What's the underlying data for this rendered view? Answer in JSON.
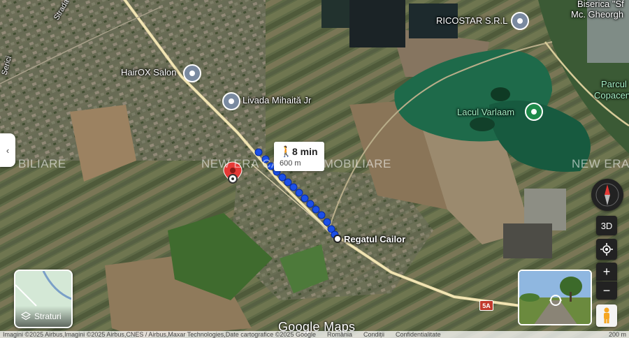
{
  "places": {
    "hairox": "HairOX Salon",
    "livada": "Livada Mihaită Jr",
    "ricostar": "RICOSTAR S.R.L",
    "biserica1": "Biserica \"Sf",
    "biserica2": "Mc. Gheorgh",
    "parcul1": "Parcul",
    "parcul2": "Copacen",
    "lacul": "Lacul Varlaam",
    "regatul": "Regatul Cailor",
    "road_label": "Strada",
    "street2": "Serici"
  },
  "watermarks": {
    "left": "BILIARE",
    "center": "NEW ERA CASA DE IMOBILIARE",
    "right": "NEW ERA"
  },
  "route": {
    "time": "8 min",
    "distance": "600 m",
    "mode_icon": "walking-icon"
  },
  "road_shield": "5A",
  "controls": {
    "layers_label": "Straturi",
    "threed": "3D",
    "zoom_in": "+",
    "zoom_out": "−",
    "collapse": "‹"
  },
  "logo": "Google Maps",
  "footer": {
    "attribution": "Imagini ©2025 Airbus,Imagini ©2025 Airbus,CNES / Airbus,Maxar Technologies,Date cartografice ©2025 Google",
    "country": "România",
    "terms": "Condiții",
    "privacy": "Confidentialitate",
    "scale": "200 m"
  },
  "colors": {
    "route_dot": "#1a4fe8",
    "destination_pin": "#e53935",
    "water": "#1e6a4a",
    "lake_label": "#a6f0c6"
  }
}
